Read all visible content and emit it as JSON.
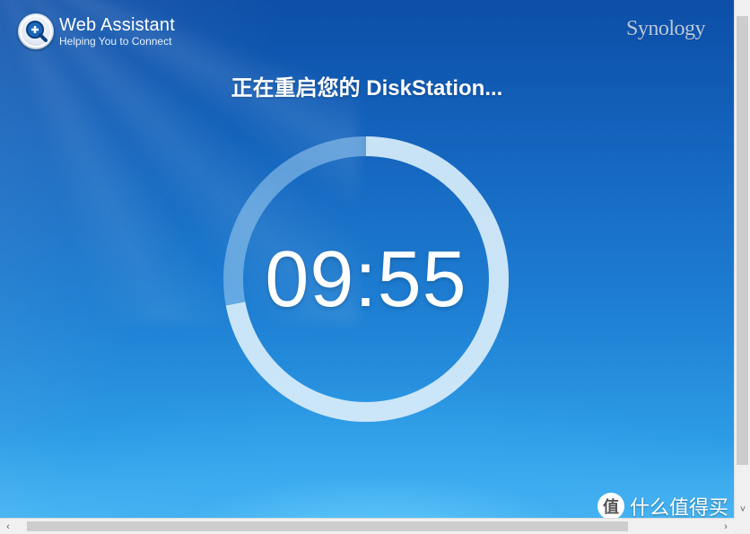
{
  "app": {
    "title": "Web Assistant",
    "subtitle": "Helping You to Connect",
    "brand": "Synology"
  },
  "main": {
    "heading": "正在重启您的 DiskStation...",
    "countdown": "09:55",
    "progress_fraction": 0.72
  },
  "scrollbars": {
    "up_arrow": "",
    "down_arrow": "˅",
    "left_arrow": "‹",
    "right_arrow": "›"
  },
  "watermark": {
    "badge": "值",
    "text": "什么值得买"
  },
  "colors": {
    "ring_track": "#4f9ad9",
    "ring_fill": "#cfe6f7",
    "accent": "#1566bf"
  },
  "icons": {
    "logo": "magnifier-plus-icon"
  }
}
